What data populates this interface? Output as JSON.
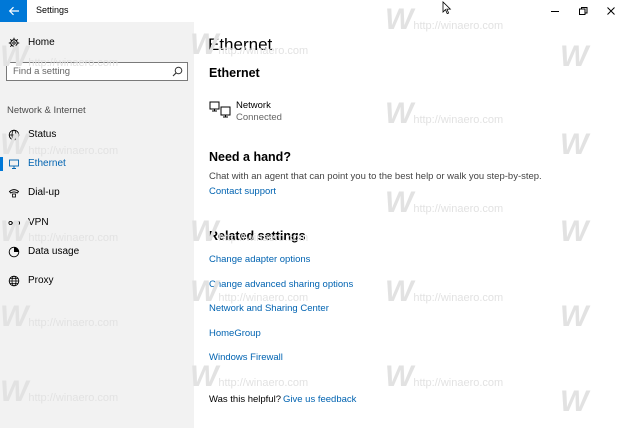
{
  "window": {
    "title": "Settings",
    "back_icon": "back-arrow-icon",
    "controls": [
      "minimize-icon",
      "maximize-icon",
      "close-icon"
    ]
  },
  "sidebar": {
    "home_label": "Home",
    "search_placeholder": "Find a setting",
    "group_label": "Network & Internet",
    "items": [
      {
        "label": "Status",
        "icon": "globe-status-icon",
        "active": false
      },
      {
        "label": "Ethernet",
        "icon": "ethernet-icon",
        "active": true
      },
      {
        "label": "Dial-up",
        "icon": "dialup-icon",
        "active": false
      },
      {
        "label": "VPN",
        "icon": "vpn-icon",
        "active": false
      },
      {
        "label": "Data usage",
        "icon": "data-usage-icon",
        "active": false
      },
      {
        "label": "Proxy",
        "icon": "globe-proxy-icon",
        "active": false
      }
    ]
  },
  "main": {
    "page_title": "Ethernet",
    "section_title": "Ethernet",
    "network": {
      "name": "Network",
      "status": "Connected",
      "icon": "computer-network-icon"
    },
    "help": {
      "title": "Need a hand?",
      "text": "Chat with an agent that can point you to the best help or walk you step-by-step.",
      "link": "Contact support"
    },
    "related": {
      "title": "Related settings",
      "links": [
        "Change adapter options",
        "Change advanced sharing options",
        "Network and Sharing Center",
        "HomeGroup",
        "Windows Firewall"
      ]
    },
    "feedback": {
      "question": "Was this helpful?",
      "link": "Give us feedback"
    }
  },
  "watermark": {
    "logo": "W",
    "url": "http://winaero.com"
  },
  "colors": {
    "accent": "#0078d7",
    "link": "#0063b1",
    "sidebar_bg": "#f2f2f2"
  }
}
